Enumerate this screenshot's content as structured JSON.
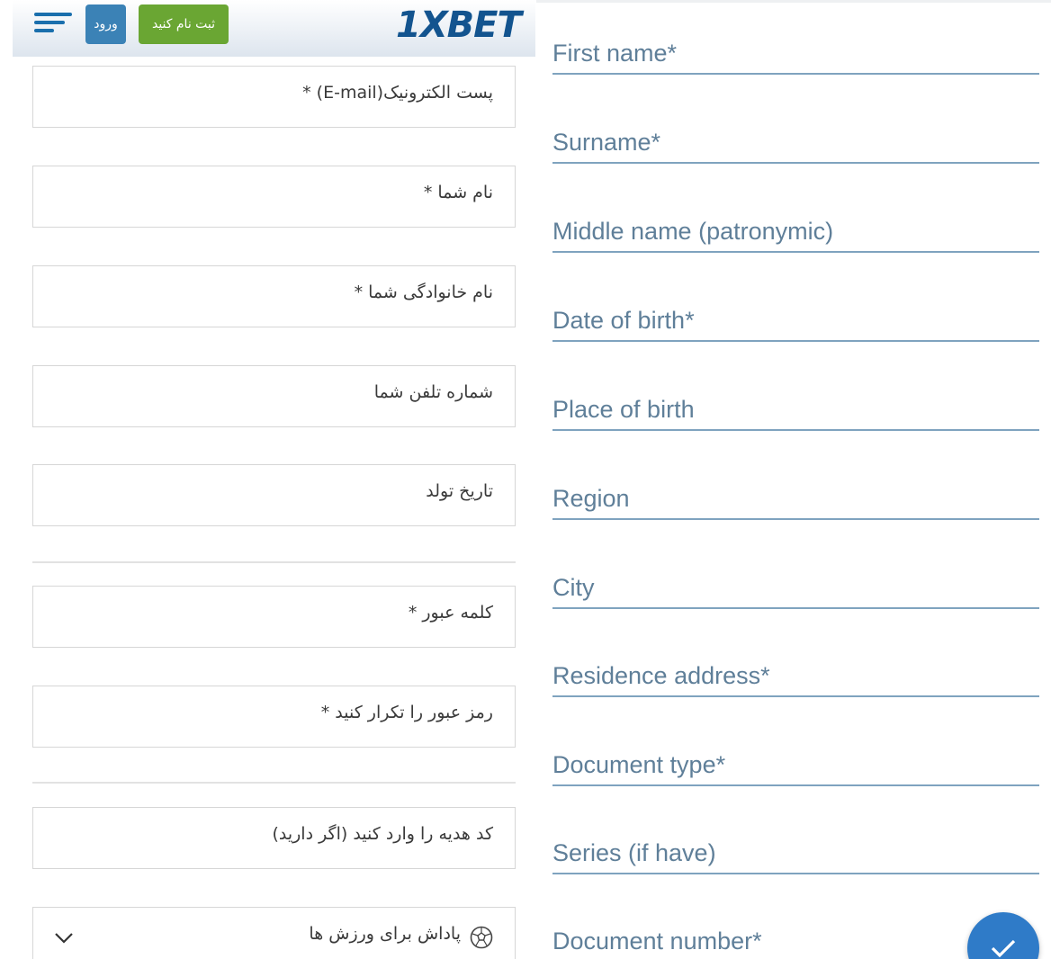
{
  "left_form": {
    "header": {
      "brand": "1XBET",
      "register_label": "ثبت نام کنید",
      "login_label": "ورود"
    },
    "fields": [
      {
        "label": "پست الکترونیک(E-mail) *"
      },
      {
        "label": "نام شما *"
      },
      {
        "label": "نام خانوادگی شما *"
      },
      {
        "label": "شماره تلفن شما"
      },
      {
        "label": "تاریخ تولد"
      },
      {
        "label": "کلمه عبور *"
      },
      {
        "label": "رمز عبور را تکرار کنید *"
      },
      {
        "label": "کد هدیه را وارد کنید (اگر دارید)"
      }
    ],
    "bonus_select": {
      "label": "پاداش برای ورزش ها"
    }
  },
  "right_form": {
    "fields": [
      {
        "label": "First name*"
      },
      {
        "label": "Surname*"
      },
      {
        "label": "Middle name (patronymic)"
      },
      {
        "label": "Date of birth*"
      },
      {
        "label": "Place of birth"
      },
      {
        "label": "Region"
      },
      {
        "label": "City"
      },
      {
        "label": "Residence address*"
      },
      {
        "label": "Document type*"
      },
      {
        "label": "Series (if have)"
      },
      {
        "label": "Document number*"
      }
    ]
  },
  "colors": {
    "brand_blue": "#13548f",
    "login_button": "#3b82b6",
    "register_button": "#6aa633",
    "field_underline": "#7fa3bf",
    "label_text": "#5f7f99",
    "fab": "#2f7bc8"
  },
  "icons": [
    "hamburger-menu-icon",
    "soccer-ball-icon",
    "chevron-down-icon",
    "check-icon"
  ]
}
